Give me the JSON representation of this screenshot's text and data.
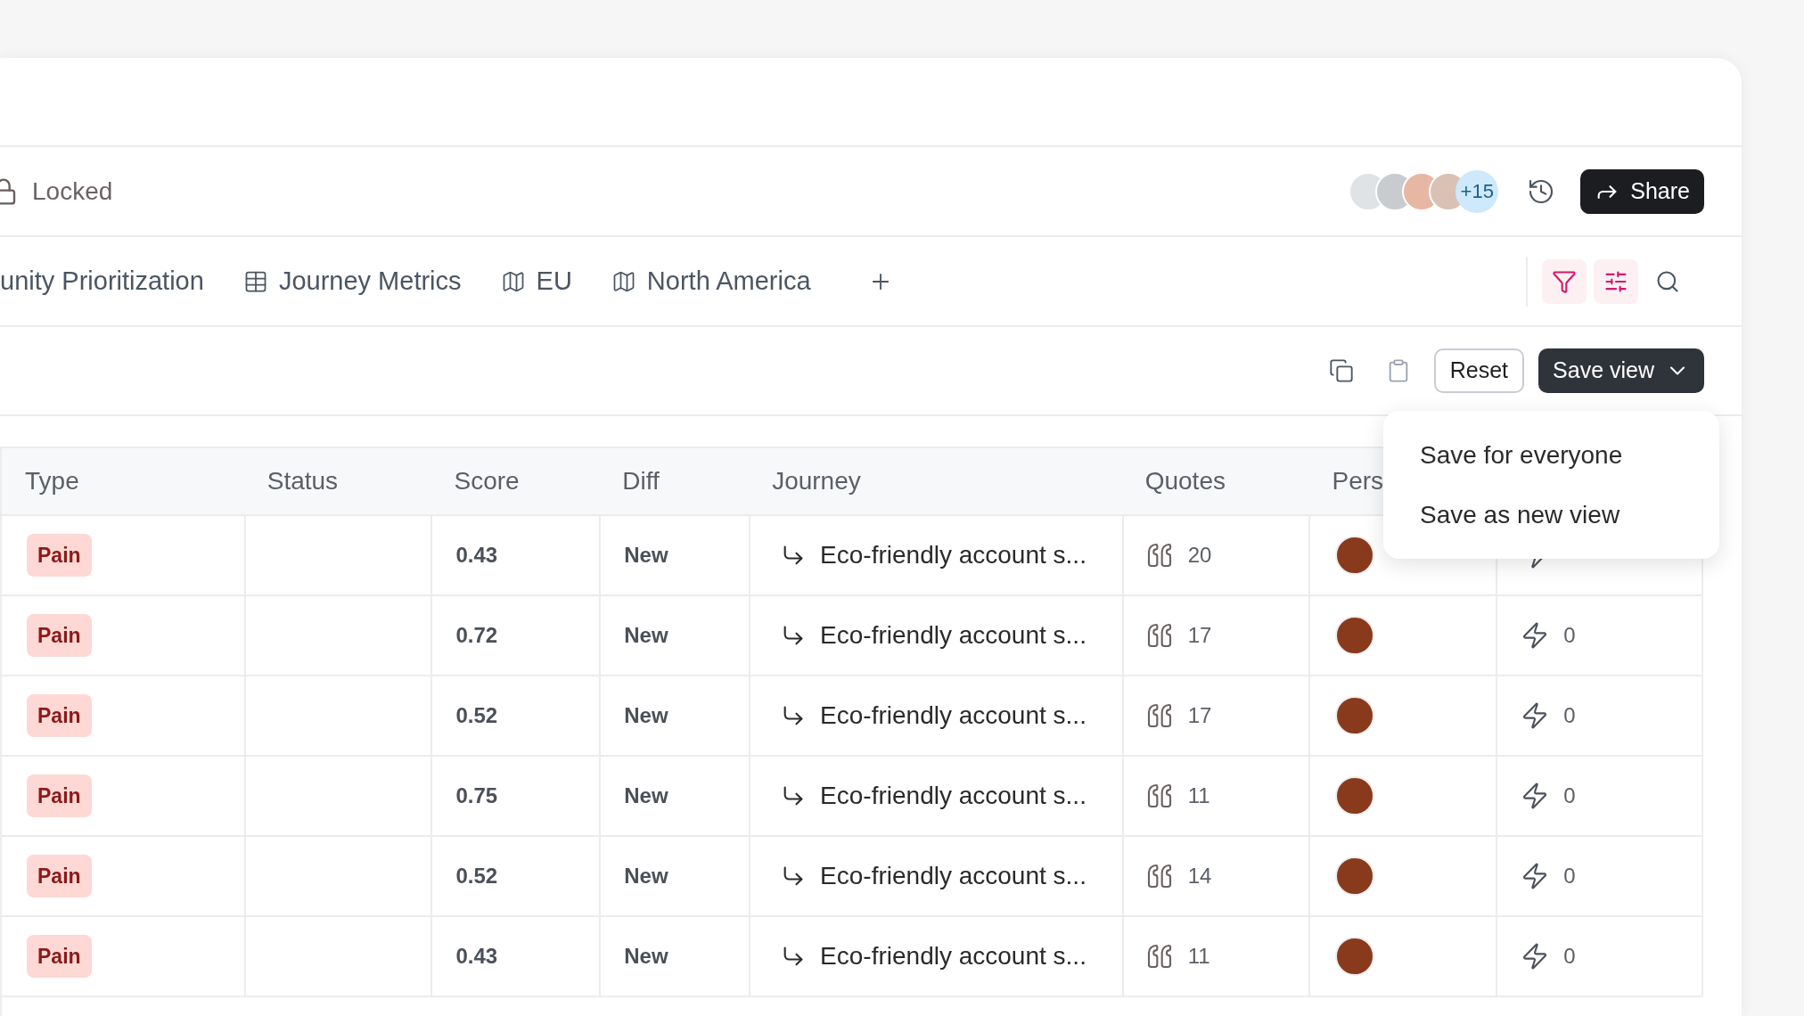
{
  "header": {
    "lock_label": "Locked",
    "collaborators": {
      "more": "+15"
    },
    "share_button": "Share"
  },
  "tabs": [
    {
      "label": "unity Prioritization",
      "kind": "text"
    },
    {
      "label": "Journey Metrics",
      "kind": "table"
    },
    {
      "label": "EU",
      "kind": "map"
    },
    {
      "label": "North America",
      "kind": "map"
    }
  ],
  "view_tools": [
    {
      "kind": "filter",
      "active": true
    },
    {
      "kind": "sliders",
      "active": true
    },
    {
      "kind": "search",
      "active": false
    }
  ],
  "toolbar": {
    "reset_button": "Reset",
    "save_button": "Save view"
  },
  "save_menu": [
    "Save for everyone",
    "Save as new view"
  ],
  "table": {
    "columns": [
      "Type",
      "Status",
      "Score",
      "Diff",
      "Journey",
      "Quotes",
      "Pers"
    ],
    "rows": [
      {
        "type": "Pain",
        "kind": "pain",
        "score": "0.43",
        "diff": "New",
        "journey": "Eco-friendly account s...",
        "quotes": "20"
      },
      {
        "type": "Pain",
        "kind": "pain",
        "score": "0.72",
        "diff": "New",
        "journey": "Eco-friendly account s...",
        "quotes": "17",
        "reactions": "0"
      },
      {
        "type": "Pain",
        "kind": "pain",
        "score": "0.52",
        "diff": "New",
        "journey": "Eco-friendly account s...",
        "quotes": "17",
        "reactions": "0"
      },
      {
        "type": "Pain",
        "kind": "pain",
        "score": "0.75",
        "diff": "New",
        "journey": "Eco-friendly account s...",
        "quotes": "11",
        "reactions": "0"
      },
      {
        "type": "Pain",
        "kind": "pain",
        "score": "0.52",
        "diff": "New",
        "journey": "Eco-friendly account s...",
        "quotes": "14",
        "reactions": "0"
      },
      {
        "type": "Pain",
        "kind": "pain",
        "score": "0.43",
        "diff": "New",
        "journey": "Eco-friendly account s...",
        "quotes": "11",
        "reactions": "0"
      }
    ]
  }
}
